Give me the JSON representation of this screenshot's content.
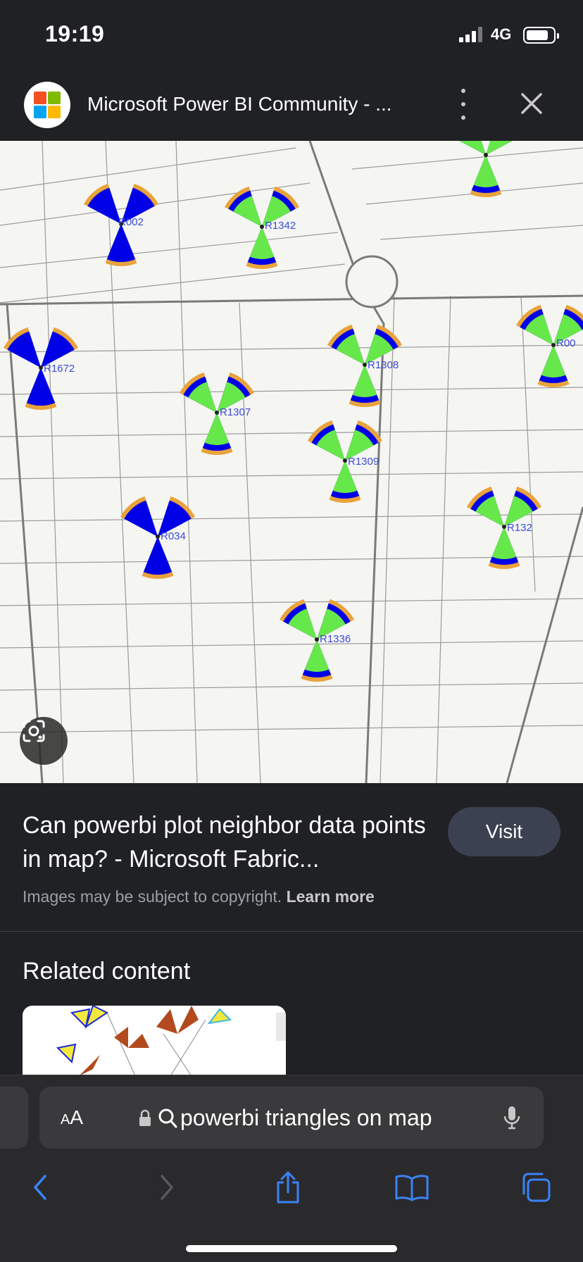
{
  "status_bar": {
    "time": "19:19",
    "network": "4G"
  },
  "tab_header": {
    "site_title": "Microsoft Power BI Community - ...",
    "logo_colors": [
      "#f25022",
      "#7fba00",
      "#00a4ef",
      "#ffb900"
    ]
  },
  "map": {
    "labels": [
      "R002",
      "R1342",
      "R1672",
      "R1308",
      "R00",
      "R1307",
      "R1309",
      "R034",
      "R132",
      "R1336"
    ],
    "colors": {
      "blue": "#0000e6",
      "green": "#66e84a",
      "orange": "#e8a33c",
      "road": "#8a8a8a"
    }
  },
  "result": {
    "title": "Can powerbi plot neighbor data points in map? - Microsoft Fabric...",
    "visit_label": "Visit",
    "copyright_text": "Images may be subject to copyright.",
    "learn_more": "Learn more"
  },
  "related": {
    "title": "Related content"
  },
  "browser": {
    "aa_label_big": "A",
    "aa_label_small": "A",
    "url_text": "powerbi triangles on map"
  }
}
